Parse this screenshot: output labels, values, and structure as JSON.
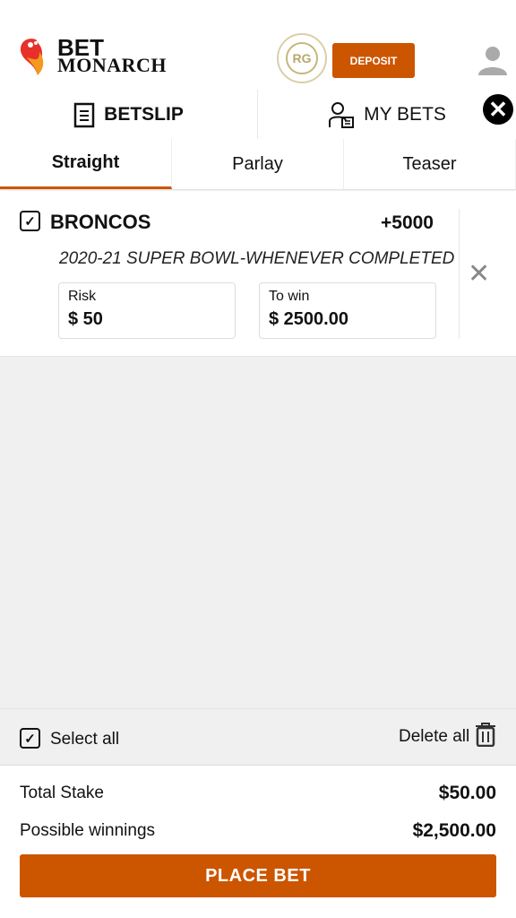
{
  "header": {
    "brand_top": "BET",
    "brand_bottom": "MONARCH",
    "rg_badge": "RG",
    "deposit_label": "DEPOSIT"
  },
  "top_tabs": [
    {
      "label": "BETSLIP",
      "active": true
    },
    {
      "label": "MY BETS",
      "active": false
    }
  ],
  "bet_type_tabs": [
    {
      "label": "Straight",
      "active": true
    },
    {
      "label": "Parlay",
      "active": false
    },
    {
      "label": "Teaser",
      "active": false
    }
  ],
  "bets": [
    {
      "team": "BRONCOS",
      "odds": "+5000",
      "event": "2020-21 SUPER BOWL-WHENEVER COMPLETED",
      "risk_label": "Risk",
      "risk_value": "$ 50",
      "win_label": "To win",
      "win_value": "$ 2500.00",
      "checked": true
    }
  ],
  "actions": {
    "select_all": "Select all",
    "delete_all": "Delete all"
  },
  "summary": {
    "total_stake_label": "Total Stake",
    "total_stake": "$50.00",
    "possible_label": "Possible winnings",
    "possible": "$2,500.00",
    "place_bet": "PLACE BET"
  },
  "colors": {
    "accent": "#cc5500"
  }
}
